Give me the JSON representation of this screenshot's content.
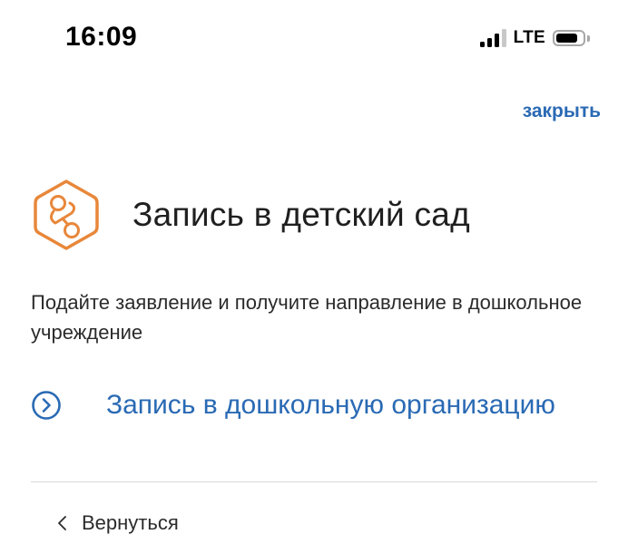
{
  "status_bar": {
    "time": "16:09",
    "network": "LTE",
    "icons": [
      "signal-icon",
      "battery-icon"
    ]
  },
  "header": {
    "close_label": "закрыть"
  },
  "service": {
    "title": "Запись в детский сад",
    "description": "Подайте заявление и получите направление в дошкольное учреждение",
    "icon": "pacifier-icon"
  },
  "actions": [
    {
      "label": "Запись в дошкольную организацию",
      "icon": "chevron-circle-icon"
    }
  ],
  "footer": {
    "back_label": "Вернуться",
    "back_icon": "chevron-left-icon"
  },
  "colors": {
    "accent": "#2a6ab4",
    "icon_orange": "#e8873a",
    "text": "#1f1f1f",
    "divider": "#d9d9d9"
  }
}
